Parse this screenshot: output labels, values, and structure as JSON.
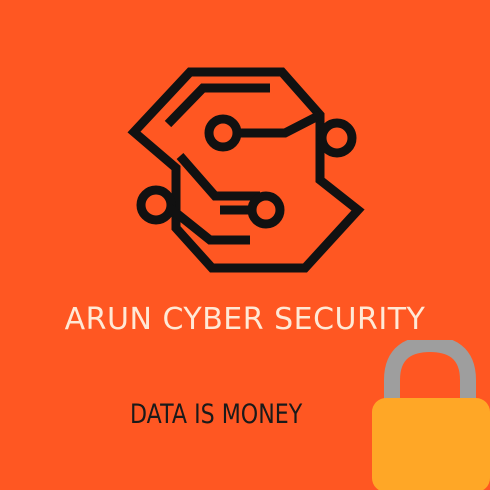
{
  "brand": {
    "name": "ARUN CYBER SECURITY",
    "tagline": "DATA IS MONEY"
  },
  "colors": {
    "background": "#FF5722",
    "logo_stroke": "#111111",
    "brand_text": "#FFE9D6",
    "tagline_text": "#1A1A1A",
    "lock_body": "#FFA726",
    "lock_shackle": "#9E9E9E"
  },
  "icons": {
    "logo": "circuit-s-logo-icon",
    "lock": "padlock-icon"
  }
}
